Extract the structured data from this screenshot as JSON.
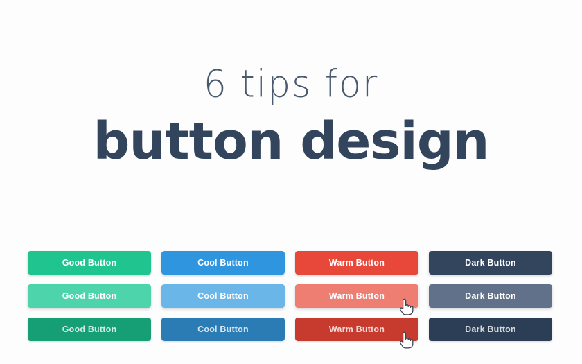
{
  "page": {
    "background_color": "#fdfdfd"
  },
  "heading": {
    "kicker": "6 tips for",
    "title": "button design",
    "kicker_color": "#4a5b70",
    "title_color": "#33455c"
  },
  "buttons": {
    "row_states": [
      "normal",
      "hover",
      "pressed"
    ],
    "columns": [
      {
        "name": "good",
        "label": "Good Button",
        "colors": {
          "normal": "#1fc48e",
          "hover": "#4ed4aa",
          "pressed": "#169e74"
        }
      },
      {
        "name": "cool",
        "label": "Cool Button",
        "colors": {
          "normal": "#2f95de",
          "hover": "#6bb6e8",
          "pressed": "#2b7bb5"
        }
      },
      {
        "name": "warm",
        "label": "Warm Button",
        "colors": {
          "normal": "#e8483a",
          "hover": "#ee7e72",
          "pressed": "#c73b2e"
        }
      },
      {
        "name": "dark",
        "label": "Dark Button",
        "colors": {
          "normal": "#33455c",
          "hover": "#61718a",
          "pressed": "#2c3e55"
        }
      }
    ],
    "cursors": [
      {
        "row": 1,
        "column": 2,
        "icon": "pointing-hand-cursor"
      },
      {
        "row": 2,
        "column": 2,
        "icon": "pointing-hand-cursor"
      }
    ]
  }
}
